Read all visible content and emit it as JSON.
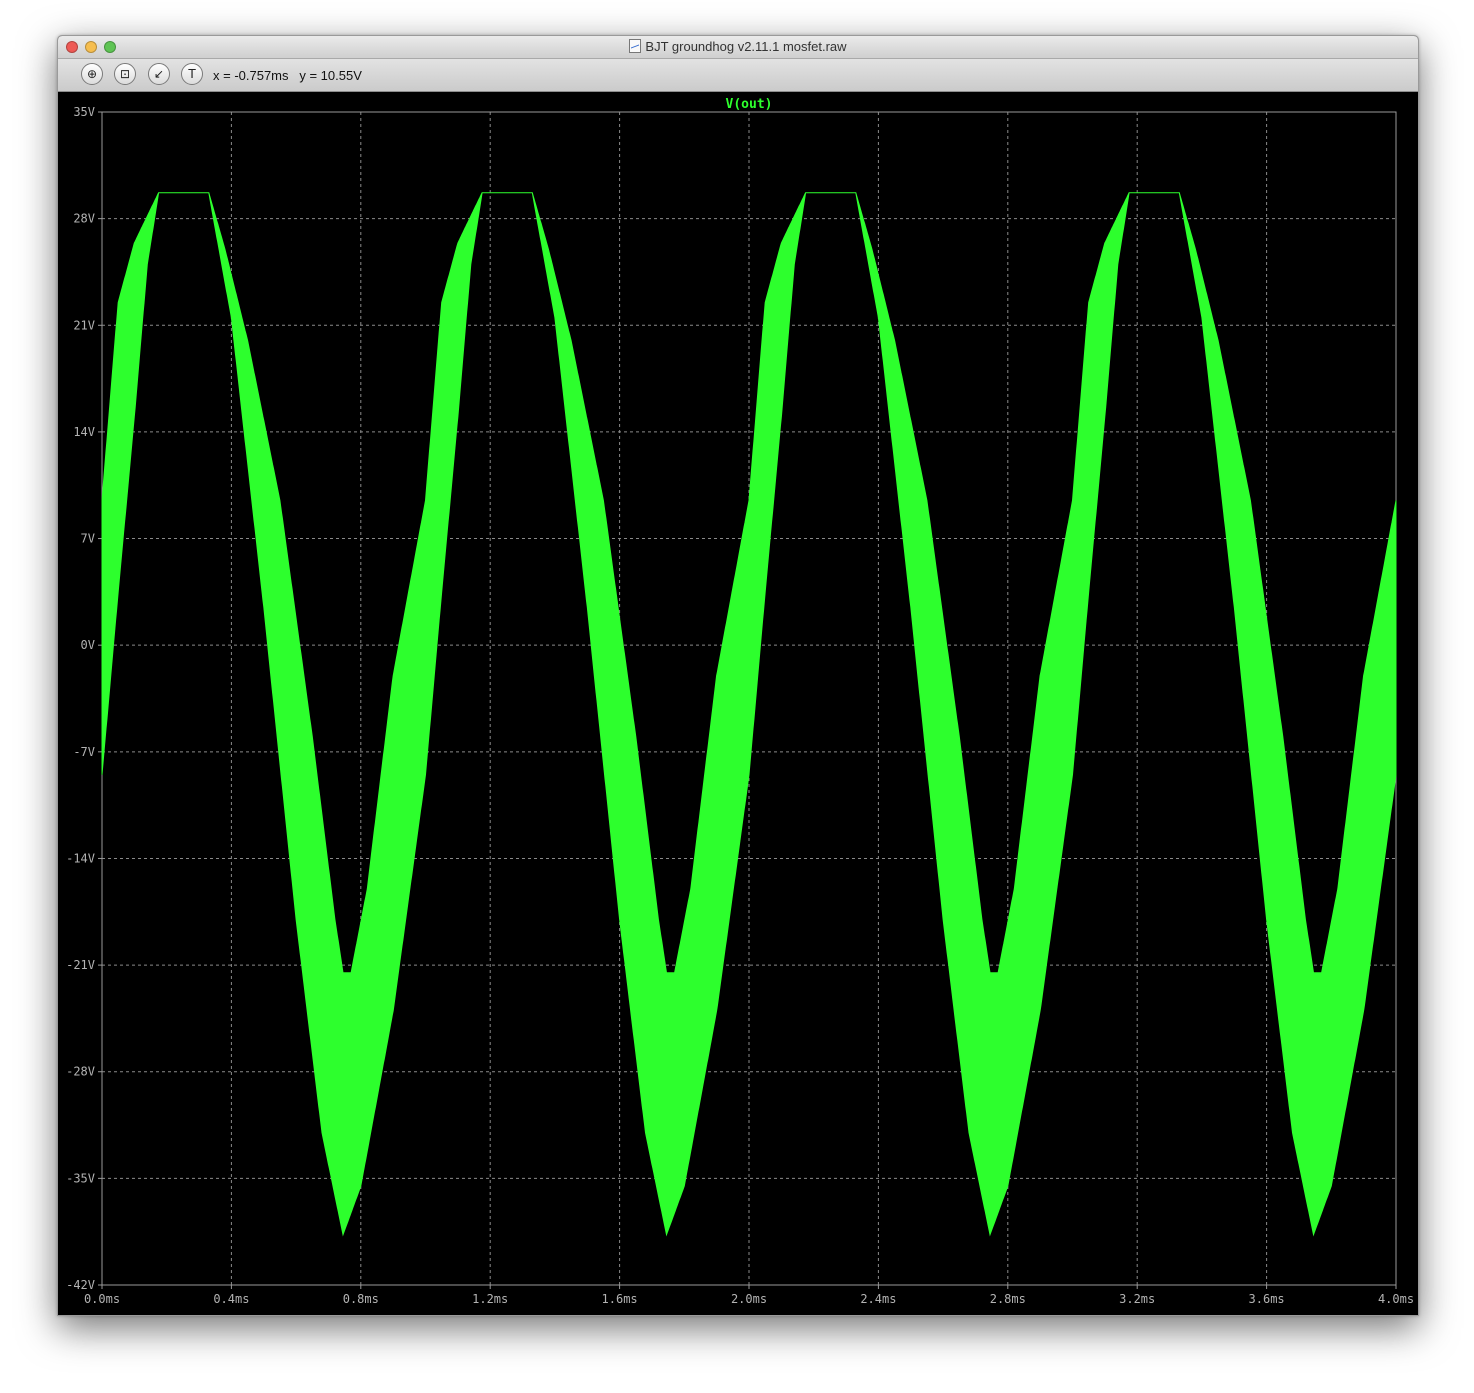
{
  "window": {
    "title": "BJT groundhog v2.11.1 mosfet.raw"
  },
  "toolbar": {
    "buttons": [
      {
        "name": "zoom-in-tool",
        "icon": "magnifier-cross-icon",
        "glyph": "⊕"
      },
      {
        "name": "zoom-fit-tool",
        "icon": "fit-frame-icon",
        "glyph": "⊡"
      },
      {
        "name": "cursor-tool",
        "icon": "cursor-axes-icon",
        "glyph": "↙"
      },
      {
        "name": "probe-tool",
        "icon": "probe-icon",
        "glyph": "T"
      }
    ],
    "cursor_readout": "x = -0.757ms   y = 10.55V"
  },
  "chart_data": {
    "type": "line",
    "title": "",
    "series": [
      {
        "name": "V(out)",
        "color": "#2dff2d"
      }
    ],
    "xlabel": "",
    "ylabel": "",
    "x_unit": "ms",
    "y_unit": "V",
    "xlim": [
      0.0,
      4.0
    ],
    "ylim": [
      -42,
      35
    ],
    "x_ticks": [
      "0.0ms",
      "0.4ms",
      "0.8ms",
      "1.2ms",
      "1.6ms",
      "2.0ms",
      "2.4ms",
      "2.8ms",
      "3.2ms",
      "3.6ms",
      "4.0ms"
    ],
    "y_ticks": [
      "35V",
      "28V",
      "21V",
      "14V",
      "7V",
      "0V",
      "-7V",
      "-14V",
      "-21V",
      "-28V",
      "-35V",
      "-42V"
    ],
    "grid": true,
    "period_ms": 1.0,
    "clip_level_v": 29.7,
    "envelope": {
      "upper": [
        {
          "x": 0.0,
          "y": 9.5
        },
        {
          "x": 0.05,
          "y": 22.5
        },
        {
          "x": 0.1,
          "y": 26.4
        },
        {
          "x": 0.15,
          "y": 28.6
        },
        {
          "x": 0.175,
          "y": 29.7
        },
        {
          "x": 0.33,
          "y": 29.7
        },
        {
          "x": 0.38,
          "y": 26.0
        },
        {
          "x": 0.45,
          "y": 20.0
        },
        {
          "x": 0.55,
          "y": 9.5
        },
        {
          "x": 0.65,
          "y": -6.0
        },
        {
          "x": 0.72,
          "y": -18.0
        },
        {
          "x": 0.745,
          "y": -21.5
        },
        {
          "x": 0.77,
          "y": -21.5
        },
        {
          "x": 0.82,
          "y": -16.0
        },
        {
          "x": 0.9,
          "y": -2.0
        },
        {
          "x": 1.0,
          "y": 9.5
        }
      ],
      "lower": [
        {
          "x": 0.0,
          "y": -8.5
        },
        {
          "x": 0.05,
          "y": 3.5
        },
        {
          "x": 0.1,
          "y": 15.0
        },
        {
          "x": 0.14,
          "y": 25.0
        },
        {
          "x": 0.175,
          "y": 29.7
        },
        {
          "x": 0.33,
          "y": 29.7
        },
        {
          "x": 0.4,
          "y": 21.5
        },
        {
          "x": 0.5,
          "y": 2.5
        },
        {
          "x": 0.6,
          "y": -18.0
        },
        {
          "x": 0.68,
          "y": -32.0
        },
        {
          "x": 0.745,
          "y": -38.7
        },
        {
          "x": 0.8,
          "y": -35.5
        },
        {
          "x": 0.9,
          "y": -24.0
        },
        {
          "x": 1.0,
          "y": -8.5
        }
      ]
    }
  }
}
